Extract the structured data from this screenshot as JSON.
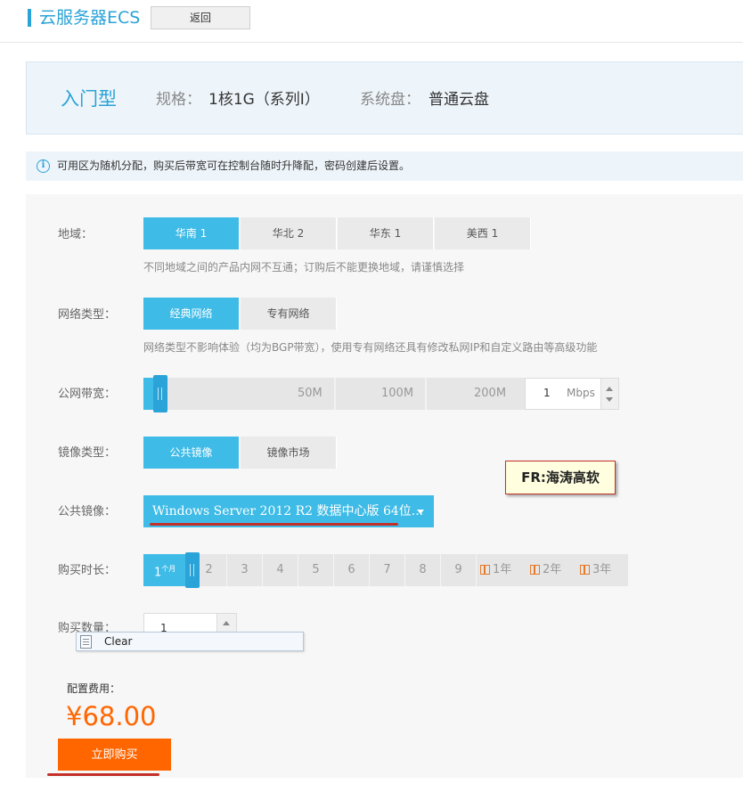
{
  "header": {
    "title": "云服务器ECS",
    "back_label": "返回"
  },
  "spec": {
    "type": "入门型",
    "spec_label": "规格：",
    "spec_value": "1核1G（系列I）",
    "disk_label": "系统盘：",
    "disk_value": "普通云盘"
  },
  "notice": {
    "text": "可用区为随机分配，购买后带宽可在控制台随时升降配，密码创建后设置。"
  },
  "region": {
    "label": "地域：",
    "options": [
      "华南 1",
      "华北 2",
      "华东 1",
      "美西 1"
    ],
    "selected": 0,
    "hint": "不同地域之间的产品内网不互通；订购后不能更换地域，请谨慎选择"
  },
  "network": {
    "label": "网络类型：",
    "options": [
      "经典网络",
      "专有网络"
    ],
    "selected": 0,
    "hint": "网络类型不影响体验（均为BGP带宽），使用专有网络还具有修改私网IP和自定义路由等高级功能"
  },
  "bandwidth": {
    "label": "公网带宽：",
    "marks": [
      "50M",
      "100M",
      "200M"
    ],
    "value": "1",
    "unit": "Mbps",
    "level_fraction": 0.02
  },
  "image_type": {
    "label": "镜像类型：",
    "options": [
      "公共镜像",
      "镜像市场"
    ],
    "selected": 0
  },
  "public_image": {
    "label": "公共镜像：",
    "selected": "Windows Server 2012 R2 数据中心版 64位..."
  },
  "annotation": {
    "note": "FR:海涛高软"
  },
  "duration": {
    "label": "购买时长：",
    "first": "1",
    "first_unit": "个月",
    "months": [
      "2",
      "3",
      "4",
      "5",
      "6",
      "7",
      "8",
      "9"
    ],
    "years": [
      "1年",
      "2年",
      "3年"
    ],
    "gift_icon": "gift-icon"
  },
  "quantity": {
    "label": "购买数量：",
    "value": "1"
  },
  "autocomplete": {
    "item": "Clear"
  },
  "cost": {
    "label": "配置费用：",
    "price": "¥68.00"
  },
  "buy": {
    "label": "立即购买"
  },
  "colors": {
    "accent": "#3ebbe6",
    "accent_dark": "#2aa3d8",
    "orange": "#ff6600",
    "annotation_red": "#c3302a"
  }
}
